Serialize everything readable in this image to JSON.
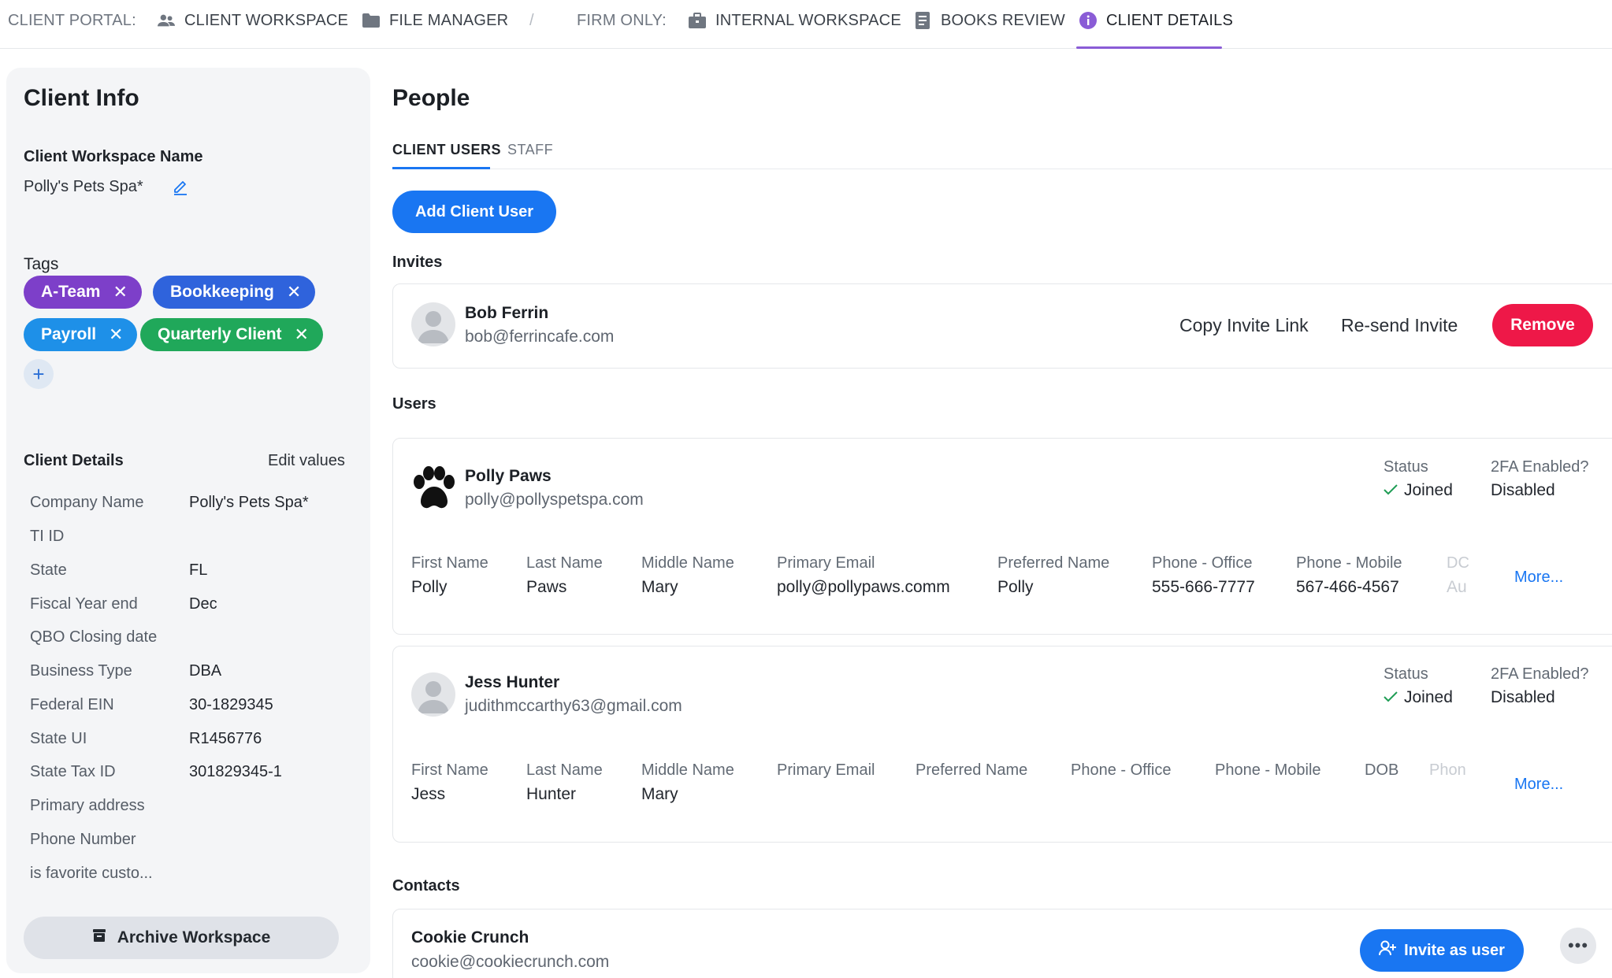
{
  "nav": {
    "client_portal_label": "CLIENT PORTAL:",
    "client_workspace": "CLIENT WORKSPACE",
    "file_manager": "FILE MANAGER",
    "separator": "/",
    "firm_only_label": "FIRM ONLY:",
    "internal_workspace": "INTERNAL WORKSPACE",
    "books_review": "BOOKS REVIEW",
    "client_details": "CLIENT DETAILS",
    "active_color": "#8a5cd6"
  },
  "client_info": {
    "title": "Client Info",
    "workspace_name_label": "Client Workspace Name",
    "workspace_name": "Polly's Pets Spa*",
    "tags_label": "Tags",
    "tags": [
      {
        "label": "A-Team",
        "color": "#7d3fc9"
      },
      {
        "label": "Bookkeeping",
        "color": "#2f63dc"
      },
      {
        "label": "Payroll",
        "color": "#1e90e8"
      },
      {
        "label": "Quarterly Client",
        "color": "#20a85a"
      }
    ],
    "add_tag": "+",
    "details_label": "Client Details",
    "edit_values": "Edit values",
    "details": [
      {
        "label": "Company Name",
        "value": "Polly's Pets Spa*"
      },
      {
        "label": "TI ID",
        "value": ""
      },
      {
        "label": "State",
        "value": "FL"
      },
      {
        "label": "Fiscal Year end",
        "value": "Dec"
      },
      {
        "label": "QBO Closing date",
        "value": ""
      },
      {
        "label": "Business Type",
        "value": "DBA"
      },
      {
        "label": "Federal EIN",
        "value": "30-1829345"
      },
      {
        "label": "State UI",
        "value": "R1456776"
      },
      {
        "label": "State Tax ID",
        "value": "301829345-1"
      },
      {
        "label": "Primary address",
        "value": ""
      },
      {
        "label": "Phone Number",
        "value": ""
      },
      {
        "label": "is favorite custo...",
        "value": ""
      }
    ],
    "archive_button": "Archive Workspace"
  },
  "people": {
    "title": "People",
    "tabs": [
      "CLIENT USERS",
      "STAFF"
    ],
    "add_client_user": "Add Client User",
    "invites_label": "Invites",
    "invite": {
      "name": "Bob Ferrin",
      "email": "bob@ferrincafe.com",
      "copy_link": "Copy Invite Link",
      "resend": "Re-send Invite",
      "remove": "Remove"
    },
    "users_label": "Users",
    "status_label": "Status",
    "twofa_label": "2FA Enabled?",
    "more": "More...",
    "users": [
      {
        "name": "Polly Paws",
        "email": "polly@pollyspetspa.com",
        "status": "Joined",
        "twofa": "Disabled",
        "avatar_icon": "paw-icon",
        "fields": [
          {
            "head": "First Name",
            "value": "Polly"
          },
          {
            "head": "Last Name",
            "value": "Paws"
          },
          {
            "head": "Middle Name",
            "value": "Mary"
          },
          {
            "head": "Primary Email",
            "value": "polly@pollypaws.comm"
          },
          {
            "head": "Preferred Name",
            "value": "Polly"
          },
          {
            "head": "Phone - Office",
            "value": "555-666-7777"
          },
          {
            "head": "Phone - Mobile",
            "value": "567-466-4567"
          },
          {
            "head": "DC",
            "value": "Au"
          }
        ]
      },
      {
        "name": "Jess Hunter",
        "email": "judithmccarthy63@gmail.com",
        "status": "Joined",
        "twofa": "Disabled",
        "avatar_icon": "default-avatar-icon",
        "fields": [
          {
            "head": "First Name",
            "value": "Jess"
          },
          {
            "head": "Last Name",
            "value": "Hunter"
          },
          {
            "head": "Middle Name",
            "value": "Mary"
          },
          {
            "head": "Primary Email",
            "value": ""
          },
          {
            "head": "Preferred Name",
            "value": ""
          },
          {
            "head": "Phone - Office",
            "value": ""
          },
          {
            "head": "Phone - Mobile",
            "value": ""
          },
          {
            "head": "DOB",
            "value": ""
          },
          {
            "head": "Phon",
            "value": ""
          }
        ]
      }
    ],
    "contacts_label": "Contacts",
    "contact": {
      "name": "Cookie Crunch",
      "email": "cookie@cookiecrunch.com",
      "invite_button": "Invite as user"
    }
  }
}
